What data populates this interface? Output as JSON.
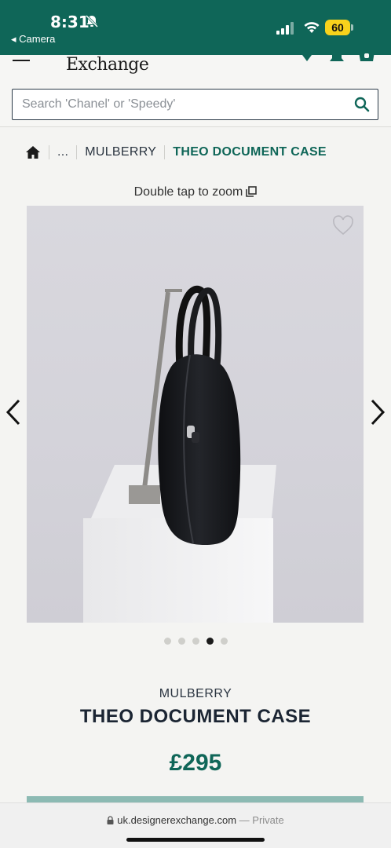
{
  "status_bar": {
    "time": "8:31",
    "back_app": "◂ Camera",
    "battery": "60"
  },
  "header": {
    "logo": "Exchange",
    "search_placeholder": "Search 'Chanel' or 'Speedy'"
  },
  "breadcrumb": {
    "ellipsis": "...",
    "brand": "MULBERRY",
    "current": "THEO DOCUMENT CASE"
  },
  "gallery": {
    "zoom_hint": "Double tap to zoom",
    "slide_count": 5,
    "active_slide": 4
  },
  "product": {
    "brand": "MULBERRY",
    "title": "THEO DOCUMENT CASE",
    "price": "£295"
  },
  "browser": {
    "url": "uk.designerexchange.com",
    "privacy": "— Private"
  },
  "colors": {
    "brand_green": "#0f6658",
    "accent_strip": "#8cbab3"
  }
}
